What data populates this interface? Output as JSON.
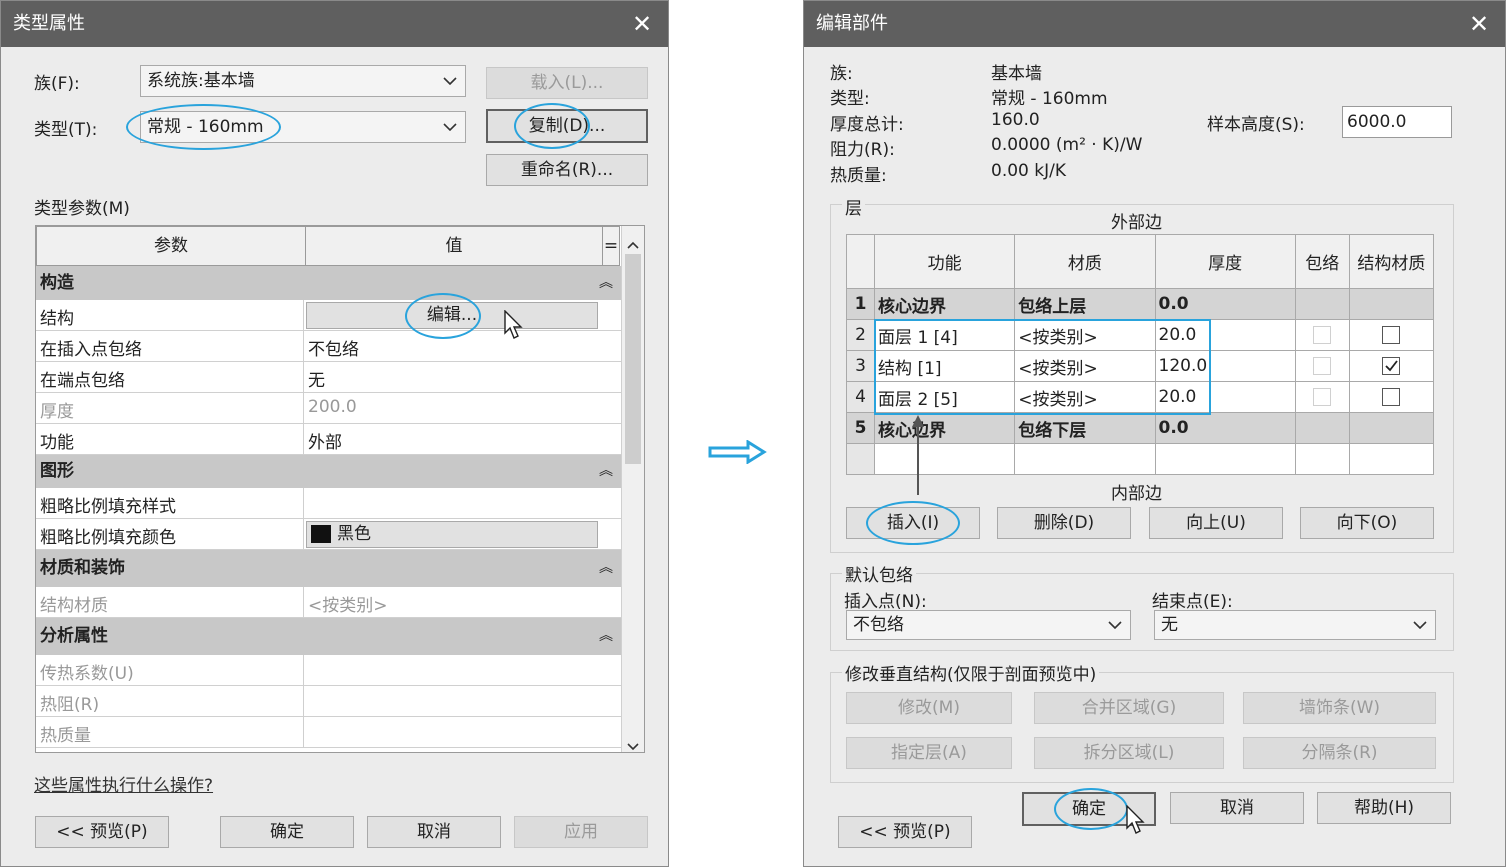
{
  "colors": {
    "titlebar": "#5f5f5f",
    "highlight_ring": "#29a3dc",
    "arrow": "#29a3dc"
  },
  "left_dialog": {
    "title": "类型属性",
    "family_label": "族(F):",
    "family_value": "系统族:基本墙",
    "type_label": "类型(T):",
    "type_value": "常规 - 160mm",
    "load_button": "载入(L)...",
    "duplicate_button": "复制(D)...",
    "rename_button": "重命名(R)...",
    "type_params_label": "类型参数(M)",
    "col_param": "参数",
    "col_value": "值",
    "col_eq": "=",
    "groups": {
      "construction": "构造",
      "graphics": "图形",
      "materials": "材质和装饰",
      "analysis": "分析属性"
    },
    "rows": {
      "structure": {
        "name": "结构",
        "value": "编辑..."
      },
      "wrap_insert": {
        "name": "在插入点包络",
        "value": "不包络"
      },
      "wrap_end": {
        "name": "在端点包络",
        "value": "无"
      },
      "thickness": {
        "name": "厚度",
        "value": "200.0"
      },
      "function": {
        "name": "功能",
        "value": "外部"
      },
      "coarse_pattern": {
        "name": "粗略比例填充样式",
        "value": ""
      },
      "coarse_color": {
        "name": "粗略比例填充颜色",
        "value": "黑色"
      },
      "struct_material": {
        "name": "结构材质",
        "value": "<按类别>"
      },
      "heat_coeff": {
        "name": "传热系数(U)",
        "value": ""
      },
      "resistance": {
        "name": "热阻(R)",
        "value": ""
      },
      "thermal_mass": {
        "name": "热质量",
        "value": ""
      }
    },
    "help_link": "这些属性执行什么操作?",
    "preview_button": "<< 预览(P)",
    "ok_button": "确定",
    "cancel_button": "取消",
    "apply_button": "应用"
  },
  "right_dialog": {
    "title": "编辑部件",
    "info": {
      "family_label": "族:",
      "family_value": "基本墙",
      "type_label": "类型:",
      "type_value": "常规 - 160mm",
      "thickness_label": "厚度总计:",
      "thickness_value": "160.0",
      "resistance_label": "阻力(R):",
      "resistance_value": "0.0000 (m² · K)/W",
      "thermal_label": "热质量:",
      "thermal_value": "0.00 kJ/K",
      "sample_height_label": "样本高度(S):",
      "sample_height_value": "6000.0"
    },
    "layers_label": "层",
    "exterior_side": "外部边",
    "interior_side": "内部边",
    "columns": [
      "功能",
      "材质",
      "厚度",
      "包络",
      "结构材质"
    ],
    "layers": [
      {
        "num": "1",
        "function": "核心边界",
        "material": "包络上层",
        "thickness": "0.0",
        "core": true
      },
      {
        "num": "2",
        "function": "面层 1 [4]",
        "material": "<按类别>",
        "thickness": "20.0",
        "core": false
      },
      {
        "num": "3",
        "function": "结构 [1]",
        "material": "<按类别>",
        "thickness": "120.0",
        "core": false
      },
      {
        "num": "4",
        "function": "面层 2 [5]",
        "material": "<按类别>",
        "thickness": "20.0",
        "core": false
      },
      {
        "num": "5",
        "function": "核心边界",
        "material": "包络下层",
        "thickness": "0.0",
        "core": true
      }
    ],
    "insert_button": "插入(I)",
    "delete_button": "删除(D)",
    "up_button": "向上(U)",
    "down_button": "向下(O)",
    "default_wrap_label": "默认包络",
    "insert_point_label": "插入点(N):",
    "insert_point_value": "不包络",
    "end_point_label": "结束点(E):",
    "end_point_value": "无",
    "modify_vertical_label": "修改垂直结构(仅限于剖面预览中)",
    "modify_button": "修改(M)",
    "merge_button": "合并区域(G)",
    "sweep_button": "墙饰条(W)",
    "assign_button": "指定层(A)",
    "split_button": "拆分区域(L)",
    "reveal_button": "分隔条(R)",
    "ok_button": "确定",
    "cancel_button": "取消",
    "help_button": "帮助(H)",
    "preview_button": "<< 预览(P)"
  },
  "icons": {
    "close": "close-icon",
    "chevron": "chevron-down-icon",
    "cursor": "mouse-cursor-icon",
    "arrow": "right-arrow-icon",
    "collapse": "collapse-icon"
  }
}
